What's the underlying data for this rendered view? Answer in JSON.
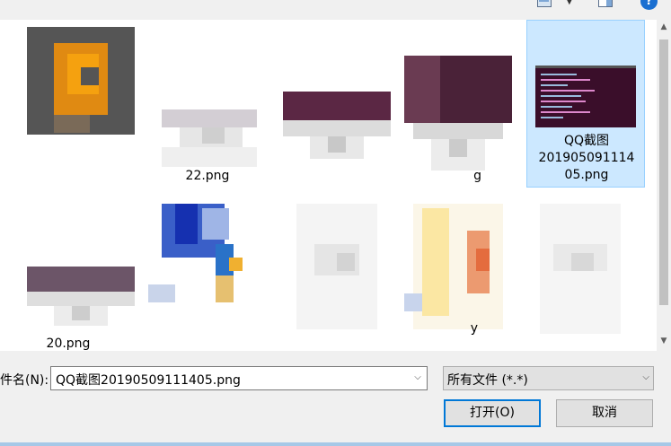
{
  "window": {
    "help_glyph": "?"
  },
  "files": [
    {
      "label": "",
      "selected": false,
      "icon": "image-thumbnail-icon"
    },
    {
      "label": "22.png",
      "selected": false,
      "icon": "image-thumbnail-icon"
    },
    {
      "label": "",
      "selected": false,
      "icon": "image-thumbnail-icon"
    },
    {
      "label": "g",
      "selected": false,
      "icon": "image-thumbnail-icon"
    },
    {
      "label_lines": [
        "QQ截图",
        "201905091114",
        "05.png"
      ],
      "selected": true,
      "icon": "terminal-screenshot-icon"
    },
    {
      "label": "20.png",
      "selected": false,
      "icon": "image-thumbnail-icon"
    },
    {
      "label": "",
      "selected": false,
      "icon": "image-thumbnail-icon"
    },
    {
      "label": "",
      "selected": false,
      "icon": "document-icon"
    },
    {
      "label": "y",
      "selected": false,
      "icon": "document-icon"
    },
    {
      "label": "",
      "selected": false,
      "icon": "document-icon"
    }
  ],
  "filename": {
    "label": "件名(N):",
    "value": "QQ截图20190509111405.png"
  },
  "filter": {
    "value": "所有文件 (*.*)"
  },
  "buttons": {
    "open": "打开(O)",
    "cancel": "取消"
  },
  "scroll": {
    "up": "▲",
    "down": "▼"
  },
  "arrow_glyph": "⌵"
}
